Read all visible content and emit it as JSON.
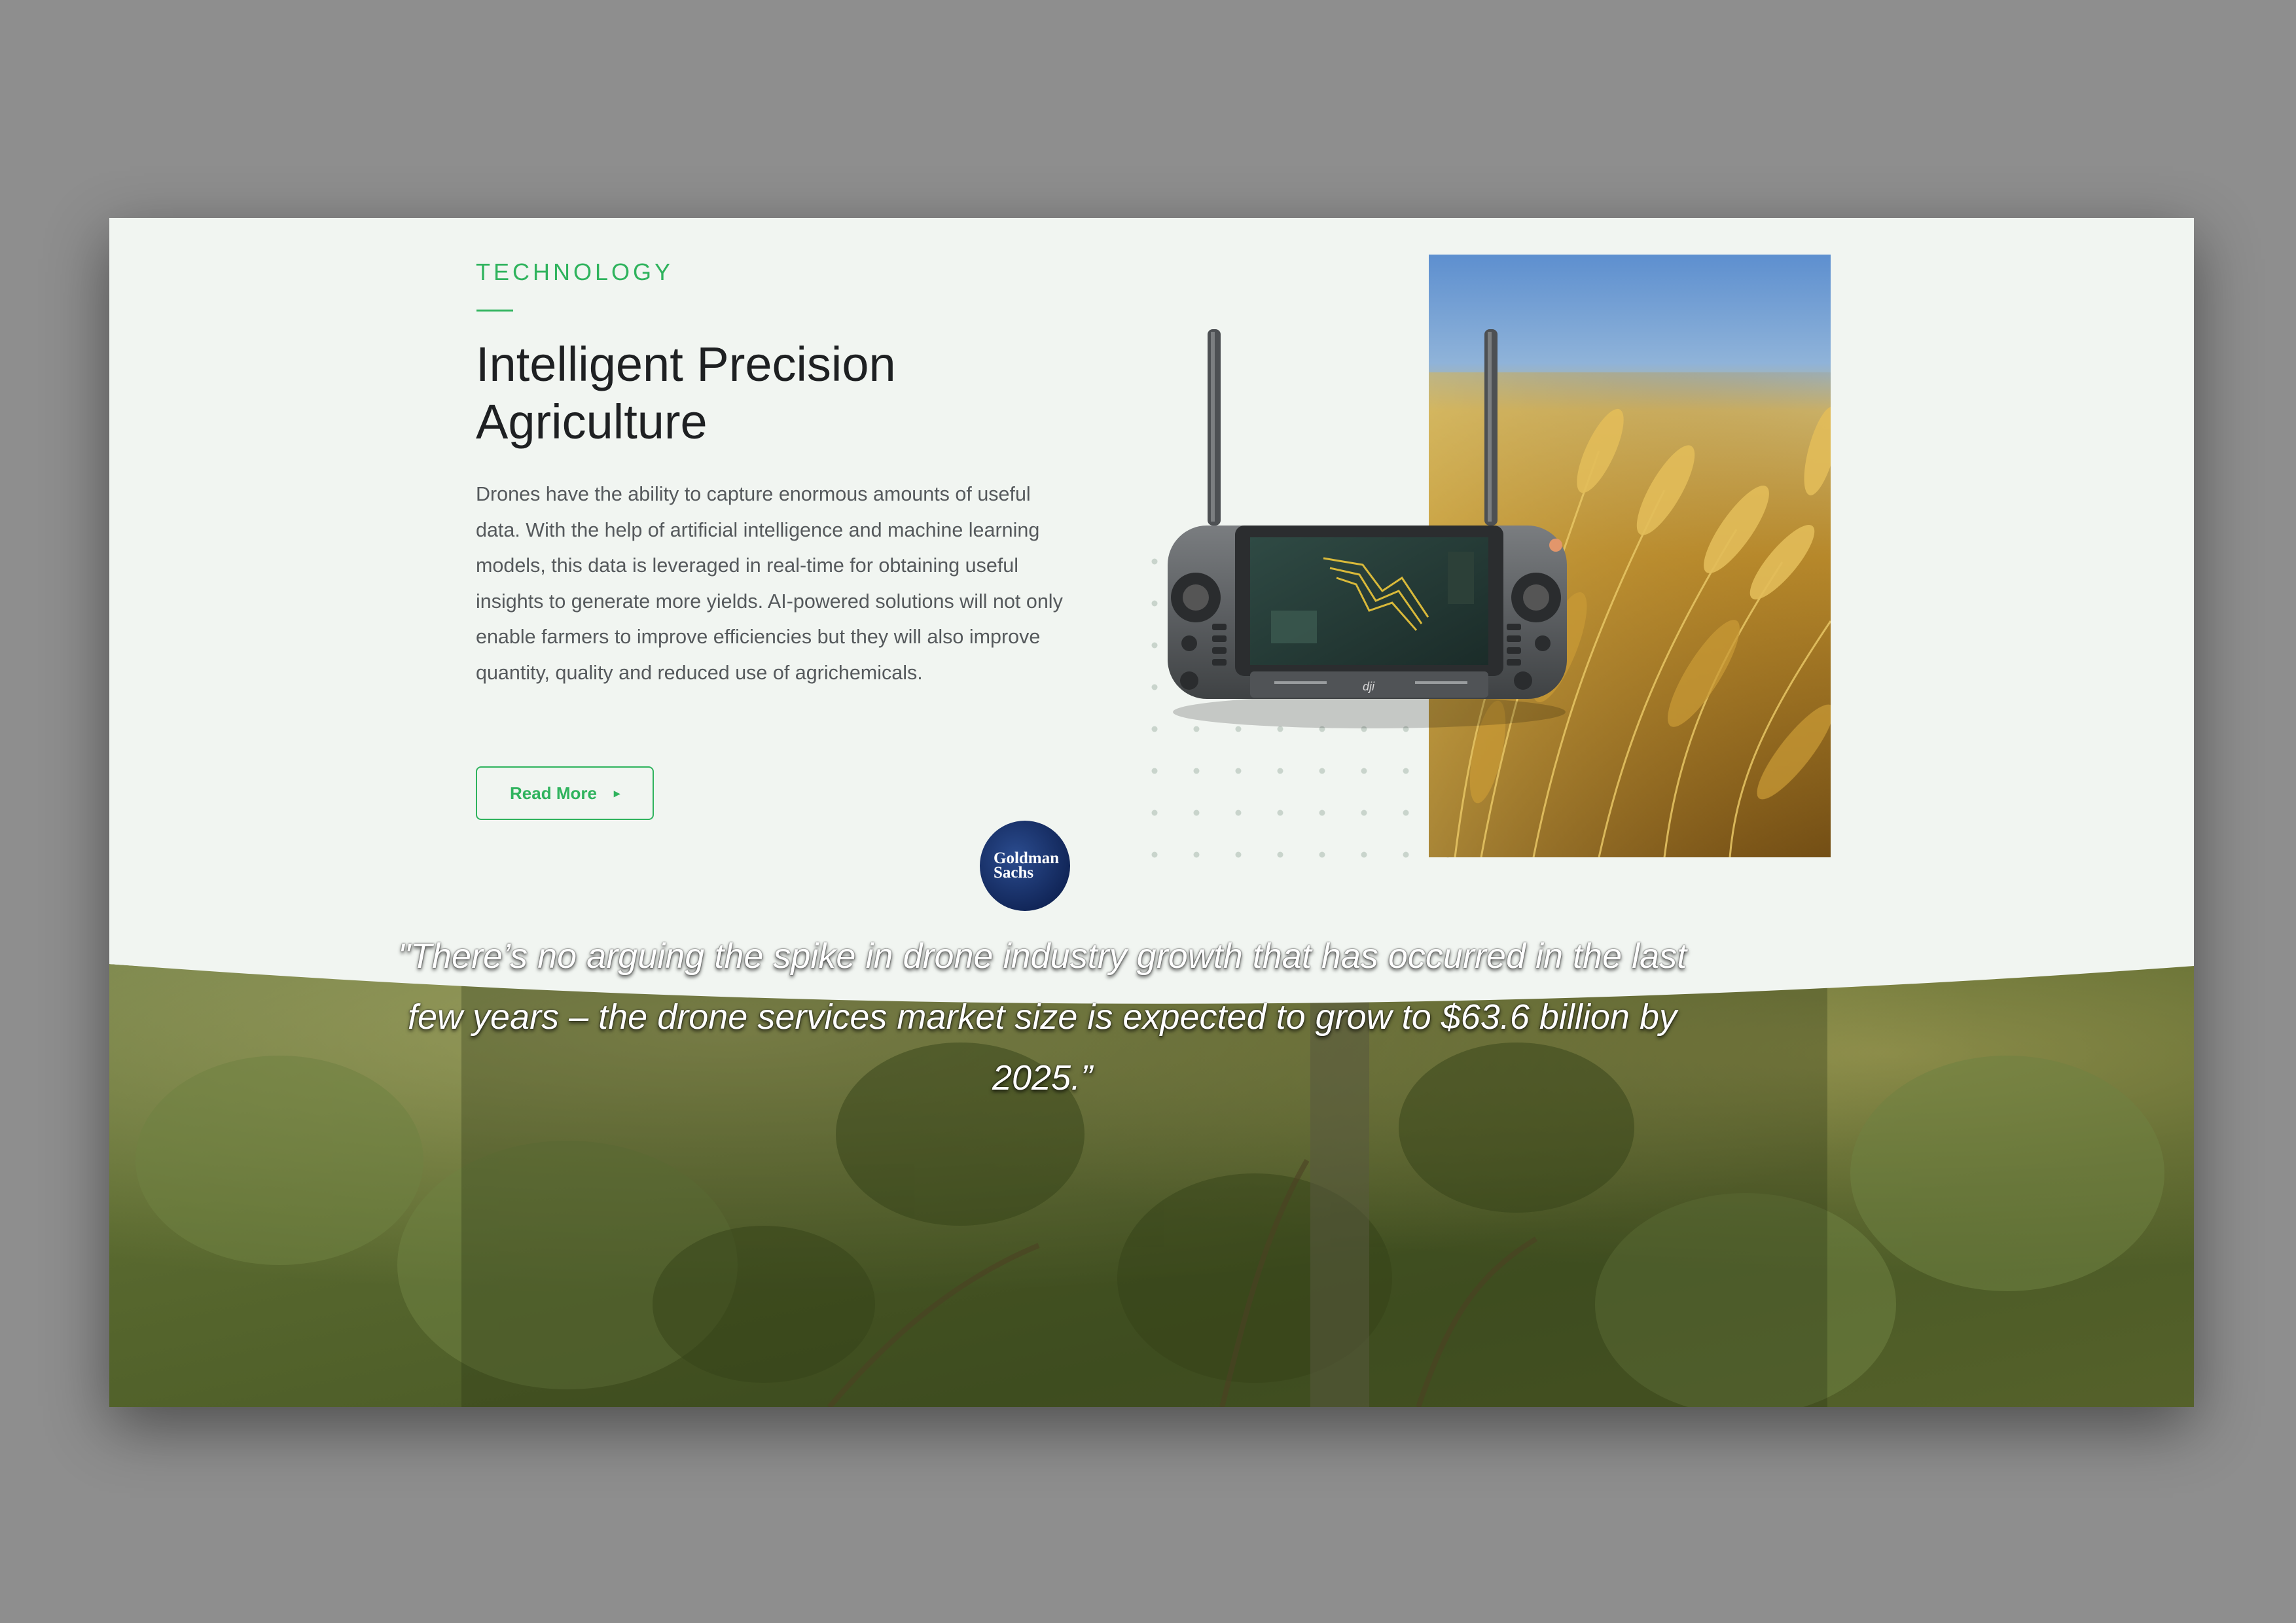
{
  "feature": {
    "eyebrow": "TECHNOLOGY",
    "title_line1": "Intelligent Precision",
    "title_line2": "Agriculture",
    "body": "Drones have the ability to capture enormous amounts of useful data. With the help of artificial intelligence and machine learning models, this data is leveraged in real-time for obtaining useful insights to generate more yields. AI-powered solutions will not only enable farmers to improve efficiencies but they will also improve quantity, quality and reduced use of agrichemicals.",
    "read_more_label": "Read More",
    "read_more_icon": "caret-right-icon"
  },
  "testimonial": {
    "logo_line1": "Goldman",
    "logo_line2": "Sachs",
    "quote": "\"There’s no arguing the spike in drone industry growth that has occurred in the last few years – the drone services market size is expected to grow to $63.6 billion by 2025.”"
  },
  "colors": {
    "accent": "#2fb35d",
    "page_bg": "#f1f5f1",
    "backdrop": "#8e8e8e",
    "heading": "#1e2022",
    "body_text": "#55595c"
  }
}
